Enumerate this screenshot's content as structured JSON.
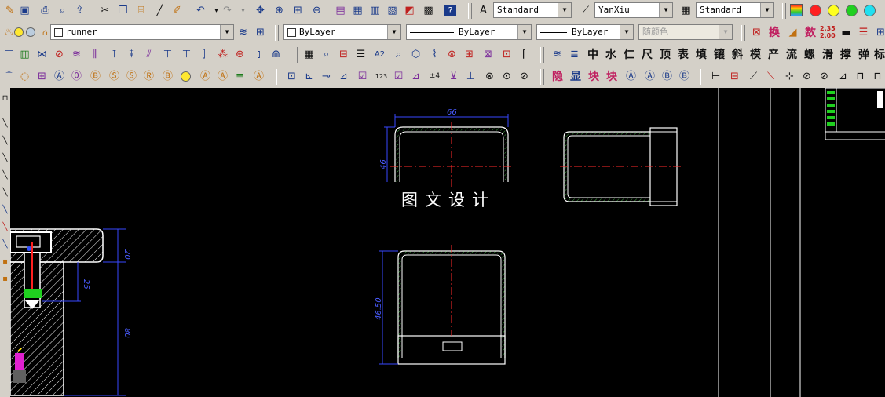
{
  "style_toolbar": {
    "text_style": "Standard",
    "dim_style": "YanXiu",
    "table_style": "Standard"
  },
  "layers_toolbar": {
    "current_layer": "runner",
    "color": "ByLayer",
    "linetype": "ByLayer",
    "lineweight": "ByLayer",
    "plot_style": "随颜色"
  },
  "chinese_tools": {
    "row2": [
      "换",
      "数"
    ],
    "row3": [
      "中",
      "水",
      "仁",
      "尺",
      "顶",
      "表",
      "填",
      "镶",
      "斜",
      "模",
      "产",
      "流",
      "螺",
      "滑",
      "撑",
      "弹",
      "标"
    ],
    "row4": [
      "隐",
      "显",
      "块",
      "块"
    ]
  },
  "ratio_icon": {
    "top": "2.35",
    "bottom": "2.00"
  },
  "palette": [
    "#ff2020",
    "#ffff20",
    "#20d020",
    "#20e0f0"
  ],
  "drawing": {
    "dims": {
      "top_width": "66",
      "top_height": "46",
      "front_height": "46.50",
      "left_top": "20",
      "left_mid": "25",
      "left_total": "80"
    },
    "watermark": "图文设计"
  }
}
